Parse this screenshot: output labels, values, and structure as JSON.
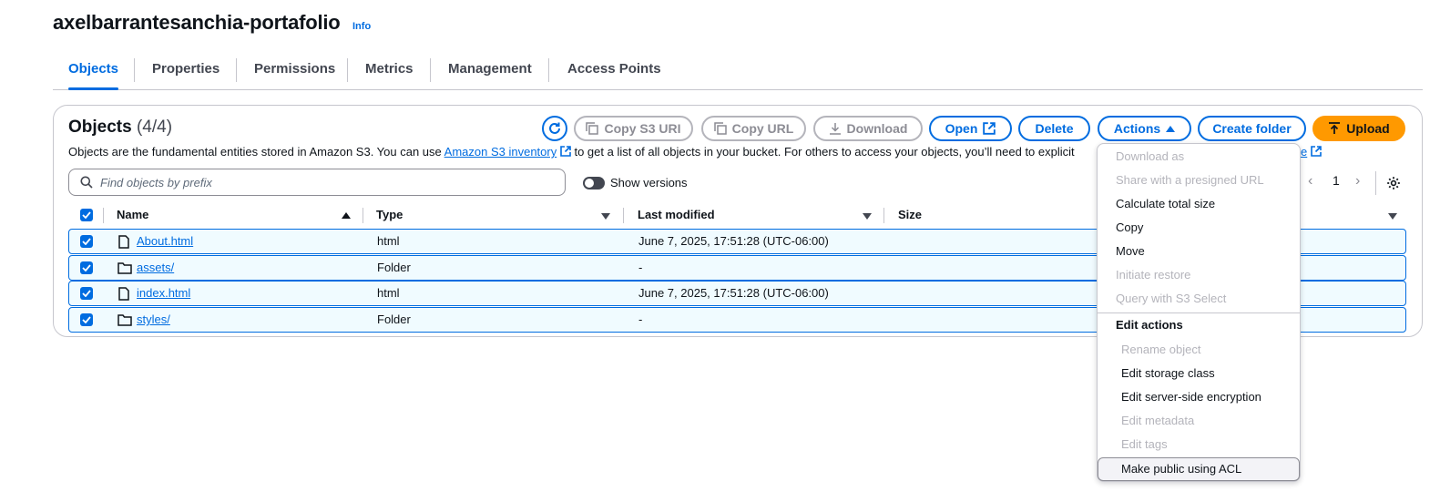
{
  "bucket": {
    "title": "axelbarrantesanchia-portafolio",
    "info": "Info"
  },
  "tabs": [
    {
      "label": "Objects",
      "active": true
    },
    {
      "label": "Properties"
    },
    {
      "label": "Permissions"
    },
    {
      "label": "Metrics"
    },
    {
      "label": "Management"
    },
    {
      "label": "Access Points"
    }
  ],
  "objects": {
    "title": "Objects",
    "count": "(4/4)",
    "desc_pre": "Objects are the fundamental entities stored in Amazon S3. You can use ",
    "desc_link": "Amazon S3 inventory",
    "desc_post": " to get a list of all objects in your bucket. For others to access your objects, you’ll need to explicit",
    "desc_tail_link": "e"
  },
  "toolbar": {
    "copy_s3_uri": "Copy S3 URI",
    "copy_url": "Copy URL",
    "download": "Download",
    "open": "Open",
    "delete": "Delete",
    "actions": "Actions",
    "create_folder": "Create folder",
    "upload": "Upload"
  },
  "search": {
    "placeholder": "Find objects by prefix"
  },
  "versions": {
    "label": "Show versions"
  },
  "pagination": {
    "page": "1"
  },
  "columns": {
    "name": "Name",
    "type": "Type",
    "last_modified": "Last modified",
    "size": "Size"
  },
  "rows": [
    {
      "name": "About.html",
      "icon": "file-icon",
      "type": "html",
      "modified": "June 7, 2025, 17:51:28 (UTC-06:00)",
      "checked": true
    },
    {
      "name": "assets/",
      "icon": "folder-icon",
      "type": "Folder",
      "modified": "-",
      "checked": true
    },
    {
      "name": "index.html",
      "icon": "file-icon",
      "type": "html",
      "modified": "June 7, 2025, 17:51:28 (UTC-06:00)",
      "checked": true
    },
    {
      "name": "styles/",
      "icon": "folder-icon",
      "type": "Folder",
      "modified": "-",
      "checked": true
    }
  ],
  "actions_menu": {
    "download_as": "Download as",
    "share_presigned": "Share with a presigned URL",
    "calculate_total_size": "Calculate total size",
    "copy": "Copy",
    "move": "Move",
    "initiate_restore": "Initiate restore",
    "query_s3_select": "Query with S3 Select",
    "edit_actions_header": "Edit actions",
    "rename_object": "Rename object",
    "edit_storage_class": "Edit storage class",
    "edit_sse": "Edit server-side encryption",
    "edit_metadata": "Edit metadata",
    "edit_tags": "Edit tags",
    "make_public_acl": "Make public using ACL"
  },
  "colors": {
    "accent": "#006ce0",
    "upload": "#ff9900",
    "selected_row": "#f0fbff",
    "disabled": "#b4b4bb"
  }
}
